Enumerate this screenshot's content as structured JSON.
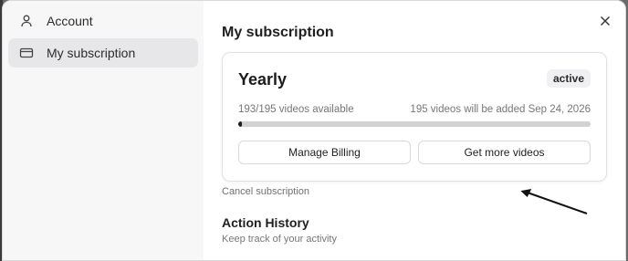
{
  "sidebar": {
    "items": [
      {
        "label": "Account",
        "icon": "user-icon"
      },
      {
        "label": "My subscription",
        "icon": "credit-card-icon"
      }
    ]
  },
  "main": {
    "title": "My subscription",
    "close_icon": "close-icon"
  },
  "subscription": {
    "plan": "Yearly",
    "status": "active",
    "usage_text": "193/195 videos available",
    "renewal_text": "195 videos will be added Sep 24, 2026",
    "usage_fraction": 0.01,
    "manage_button": "Manage Billing",
    "more_button": "Get more videos"
  },
  "cancel_link": "Cancel subscription",
  "history": {
    "title": "Action History",
    "subtitle": "Keep track of your activity"
  },
  "colors": {
    "accent": "#1e1e1e",
    "sidebar_bg": "#f7f7f8",
    "active_item_bg": "#e7e7ea"
  }
}
